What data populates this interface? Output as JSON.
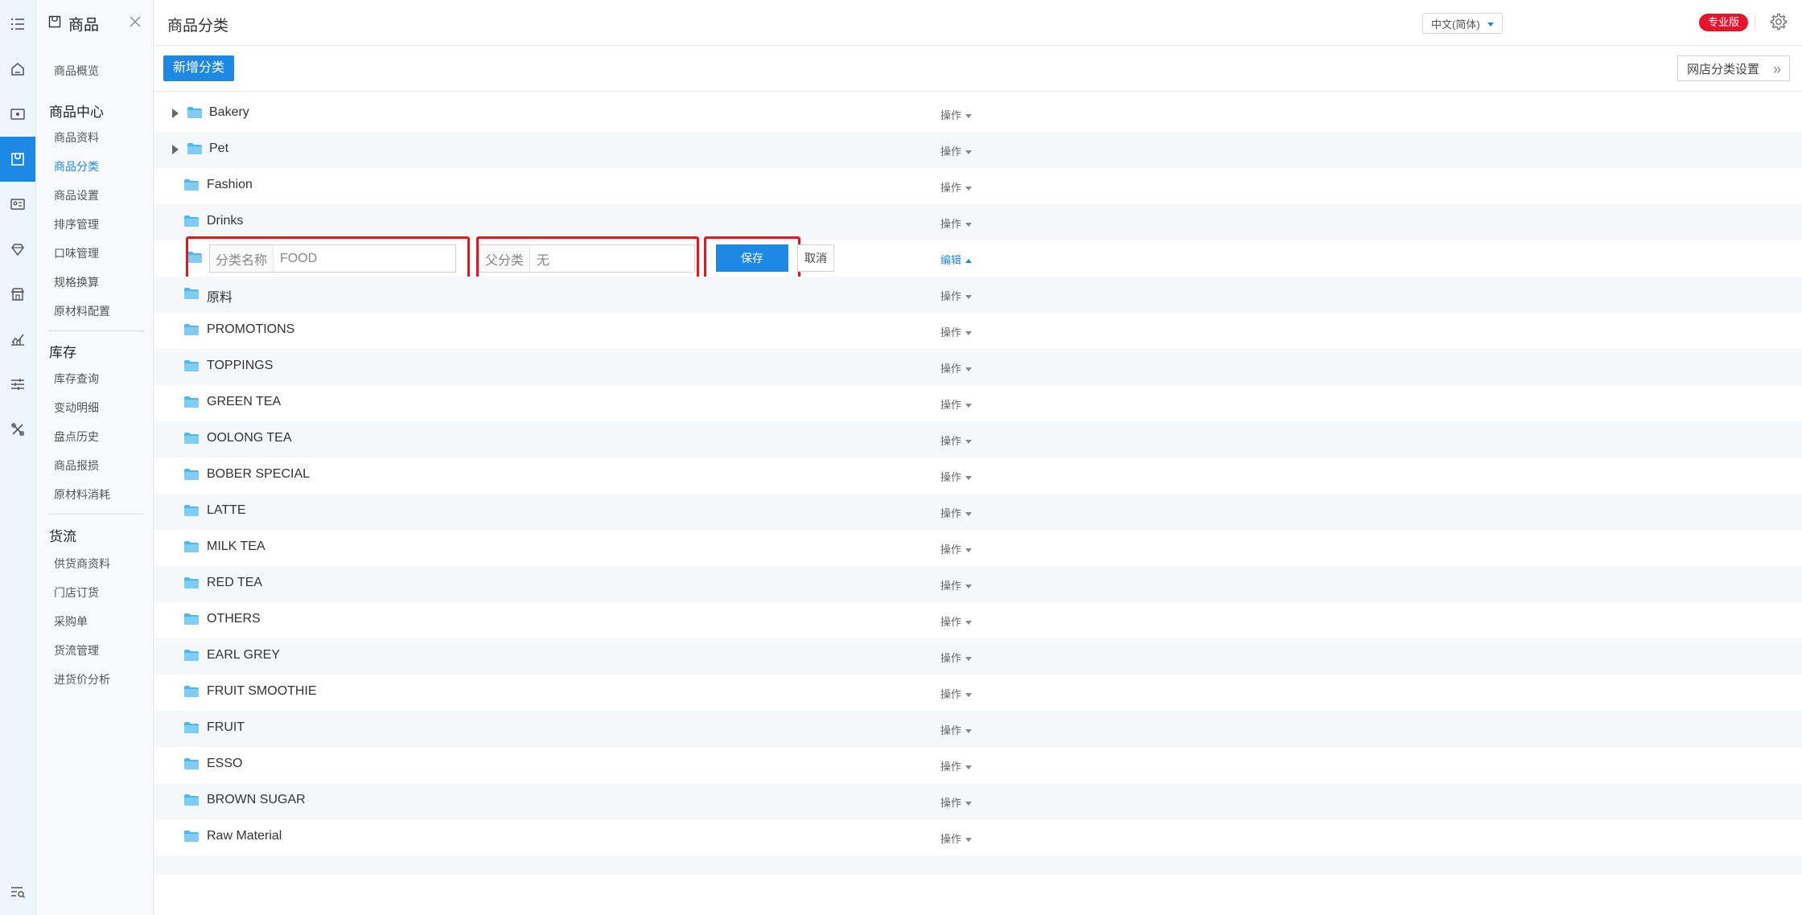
{
  "sidebar": {
    "title": "商品",
    "top_link": "商品概览",
    "sections": [
      {
        "title": "商品中心",
        "items": [
          "商品资料",
          "商品分类",
          "商品设置",
          "排序管理",
          "口味管理",
          "规格换算",
          "原材料配置"
        ]
      },
      {
        "title": "库存",
        "items": [
          "库存查询",
          "变动明细",
          "盘点历史",
          "商品报损",
          "原材料消耗"
        ]
      },
      {
        "title": "货流",
        "items": [
          "供货商资料",
          "门店订货",
          "采购单",
          "货流管理",
          "进货价分析"
        ]
      }
    ],
    "active_item": "商品分类"
  },
  "header": {
    "title": "商品分类",
    "language": "中文(简体)",
    "edition_badge": "专业版"
  },
  "toolbar": {
    "add_label": "新增分类",
    "shop_settings_label": "网店分类设置"
  },
  "list": {
    "op_label": "操作",
    "edit_op_label": "编辑",
    "rows_before": [
      {
        "name": "Bakery",
        "expandable": true
      },
      {
        "name": "Pet",
        "expandable": true
      },
      {
        "name": "Fashion",
        "expandable": false
      },
      {
        "name": "Drinks",
        "expandable": false
      }
    ],
    "edit_row": {
      "name_label": "分类名称",
      "name_value": "FOOD",
      "parent_label": "父分类",
      "parent_value": "无",
      "save_label": "保存",
      "cancel_label": "取消"
    },
    "rows_after": [
      {
        "name": "原料"
      },
      {
        "name": "PROMOTIONS"
      },
      {
        "name": "TOPPINGS"
      },
      {
        "name": "GREEN TEA"
      },
      {
        "name": "OOLONG TEA"
      },
      {
        "name": "BOBER SPECIAL"
      },
      {
        "name": "LATTE"
      },
      {
        "name": "MILK TEA"
      },
      {
        "name": "RED TEA"
      },
      {
        "name": "OTHERS"
      },
      {
        "name": "EARL GREY"
      },
      {
        "name": "FRUIT SMOOTHIE"
      },
      {
        "name": "FRUIT"
      },
      {
        "name": "ESSO"
      },
      {
        "name": "BROWN SUGAR"
      },
      {
        "name": "Raw Material"
      }
    ]
  },
  "colors": {
    "accent": "#1e88e5",
    "highlight": "#e8141e",
    "badge": "#e8142b",
    "folder": "#4db8f0"
  },
  "icons": {
    "rail": [
      "menu-list-icon",
      "home-icon",
      "screen-icon",
      "goods-icon",
      "member-card-icon",
      "diamond-icon",
      "shop-icon",
      "chart-icon",
      "sliders-icon",
      "tools-icon"
    ],
    "rail_bottom": "list-search-icon",
    "sidebar_title": "goods-box-icon",
    "sidebar_close": "close-icon",
    "settings": "gear-icon",
    "row": "folder-icon"
  }
}
